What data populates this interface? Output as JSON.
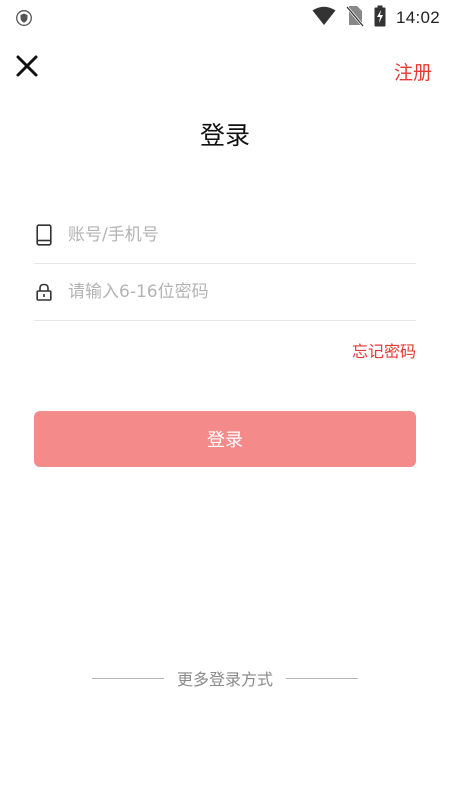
{
  "status_bar": {
    "time": "14:02",
    "icons": [
      "shield-icon",
      "wifi-icon",
      "no-sim-icon",
      "battery-charging-icon"
    ]
  },
  "header": {
    "close_icon": "close-icon",
    "register_label": "注册",
    "title": "登录"
  },
  "form": {
    "account": {
      "icon": "phone-icon",
      "placeholder": "账号/手机号",
      "value": ""
    },
    "password": {
      "icon": "lock-icon",
      "placeholder": "请输入6-16位密码",
      "value": ""
    },
    "forgot_label": "忘记密码",
    "login_label": "登录"
  },
  "footer": {
    "more_login_label": "更多登录方式"
  },
  "colors": {
    "accent": "#e53935",
    "button_bg": "#f48a8a",
    "placeholder": "#b3b3b3",
    "divider": "#e6e6e6"
  }
}
